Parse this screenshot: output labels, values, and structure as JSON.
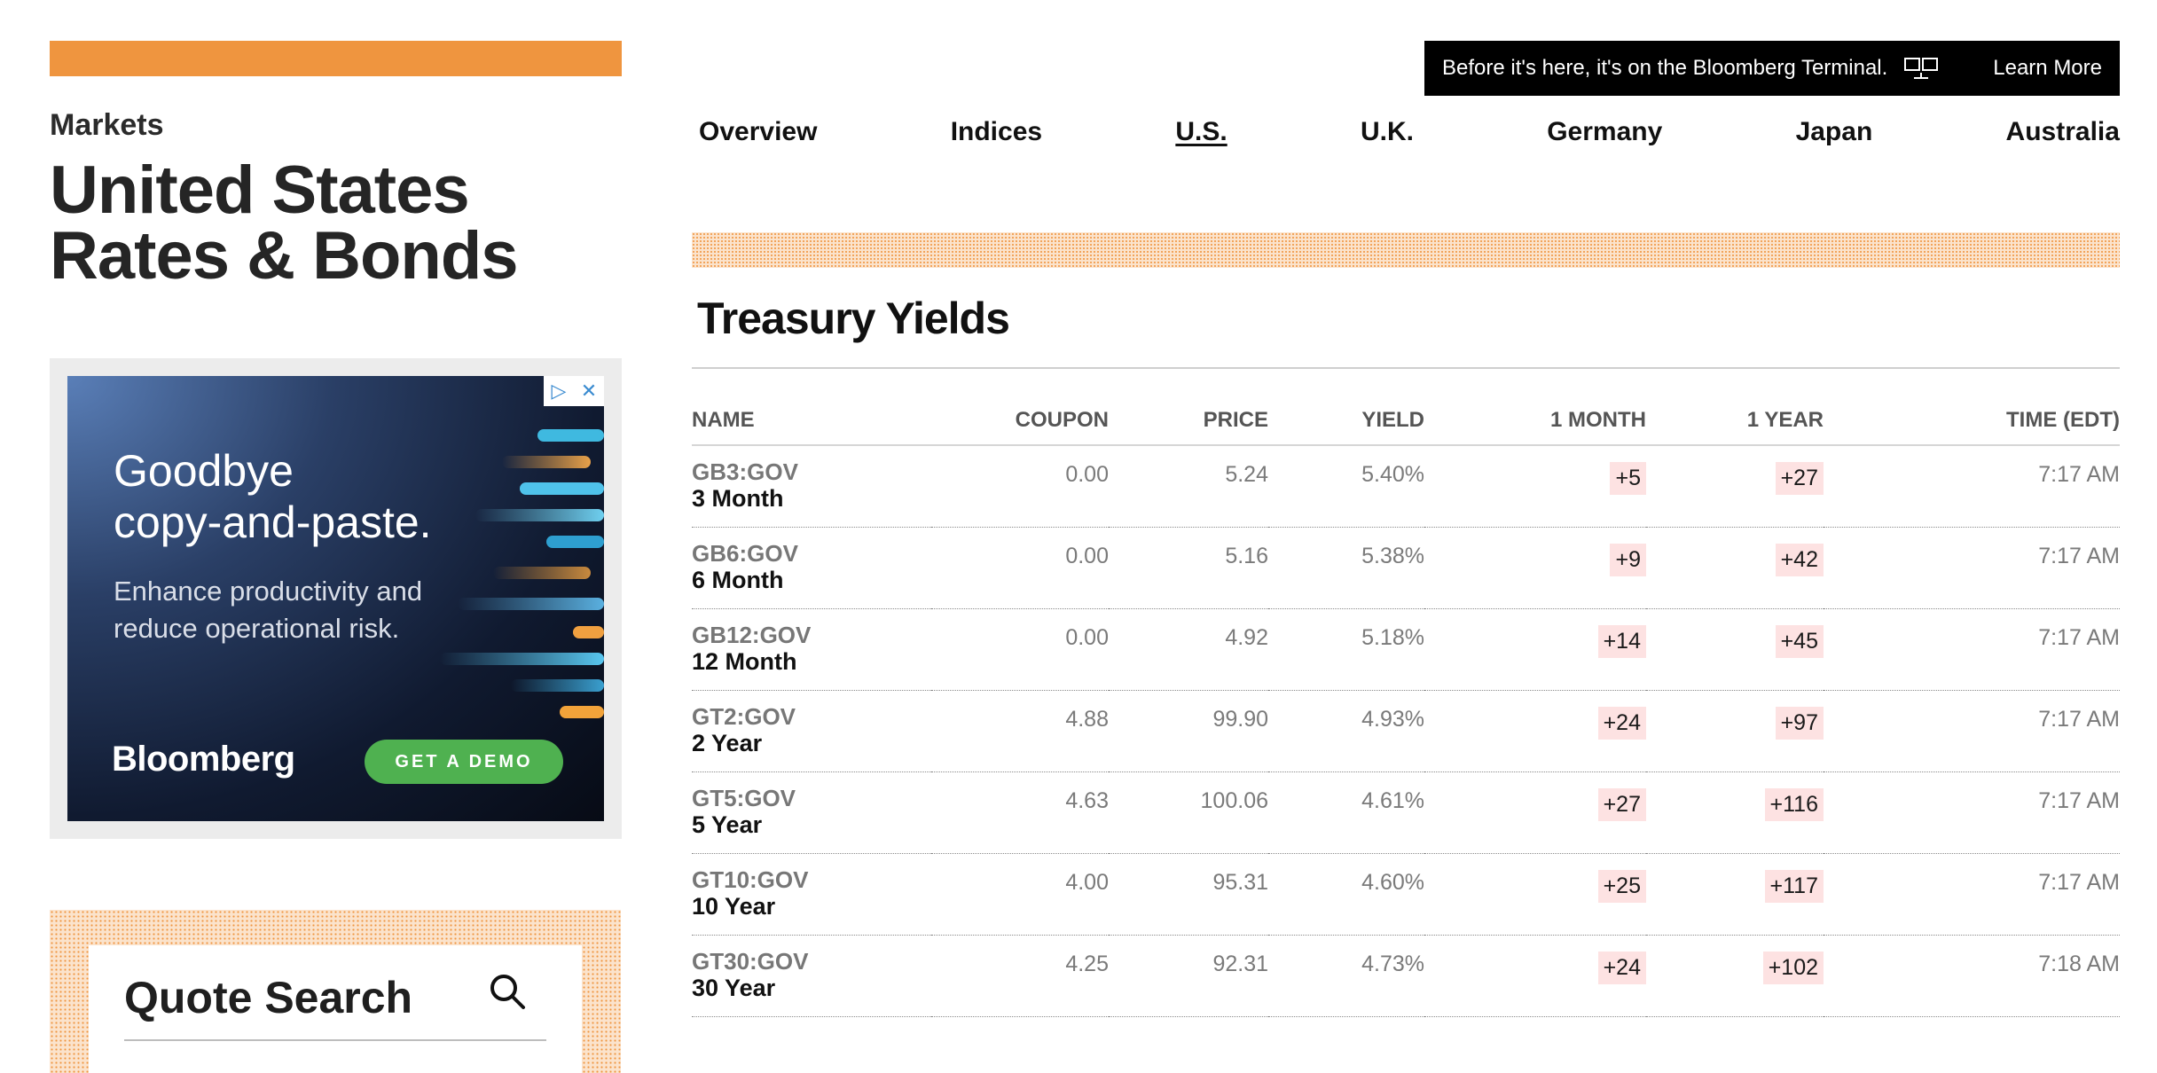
{
  "left": {
    "section_label": "Markets",
    "title": "United States\nRates & Bonds"
  },
  "ad": {
    "headline": "Goodbye\ncopy-and-paste.",
    "subtext": "Enhance productivity and\nreduce operational risk.",
    "brand": "Bloomberg",
    "cta": "GET A DEMO",
    "adchoices_icon": "adchoices-icon",
    "close_icon": "close-icon"
  },
  "quote_search": {
    "title": "Quote Search",
    "icon": "search-icon"
  },
  "banner": {
    "text": "Before it's here, it's on the Bloomberg Terminal.",
    "icon": "terminal-icon",
    "link": "Learn More"
  },
  "nav": {
    "items": [
      "Overview",
      "Indices",
      "U.S.",
      "U.K.",
      "Germany",
      "Japan",
      "Australia"
    ],
    "active": "U.S."
  },
  "table": {
    "title": "Treasury Yields",
    "headers": {
      "name": "NAME",
      "coupon": "COUPON",
      "price": "PRICE",
      "yield": "YIELD",
      "month": "1 MONTH",
      "year": "1 YEAR",
      "time": "TIME (EDT)"
    },
    "rows": [
      {
        "ticker": "GB3:GOV",
        "tenor": "3 Month",
        "coupon": "0.00",
        "price": "5.24",
        "yield": "5.40%",
        "month": "+5",
        "year": "+27",
        "time": "7:17 AM"
      },
      {
        "ticker": "GB6:GOV",
        "tenor": "6 Month",
        "coupon": "0.00",
        "price": "5.16",
        "yield": "5.38%",
        "month": "+9",
        "year": "+42",
        "time": "7:17 AM"
      },
      {
        "ticker": "GB12:GOV",
        "tenor": "12 Month",
        "coupon": "0.00",
        "price": "4.92",
        "yield": "5.18%",
        "month": "+14",
        "year": "+45",
        "time": "7:17 AM"
      },
      {
        "ticker": "GT2:GOV",
        "tenor": "2 Year",
        "coupon": "4.88",
        "price": "99.90",
        "yield": "4.93%",
        "month": "+24",
        "year": "+97",
        "time": "7:17 AM"
      },
      {
        "ticker": "GT5:GOV",
        "tenor": "5 Year",
        "coupon": "4.63",
        "price": "100.06",
        "yield": "4.61%",
        "month": "+27",
        "year": "+116",
        "time": "7:17 AM"
      },
      {
        "ticker": "GT10:GOV",
        "tenor": "10 Year",
        "coupon": "4.00",
        "price": "95.31",
        "yield": "4.60%",
        "month": "+25",
        "year": "+117",
        "time": "7:17 AM"
      },
      {
        "ticker": "GT30:GOV",
        "tenor": "30 Year",
        "coupon": "4.25",
        "price": "92.31",
        "yield": "4.73%",
        "month": "+24",
        "year": "+102",
        "time": "7:18 AM"
      }
    ]
  },
  "colors": {
    "accent_orange": "#ef953f",
    "change_bg": "#fde2e2",
    "cta_green": "#4fb150"
  }
}
